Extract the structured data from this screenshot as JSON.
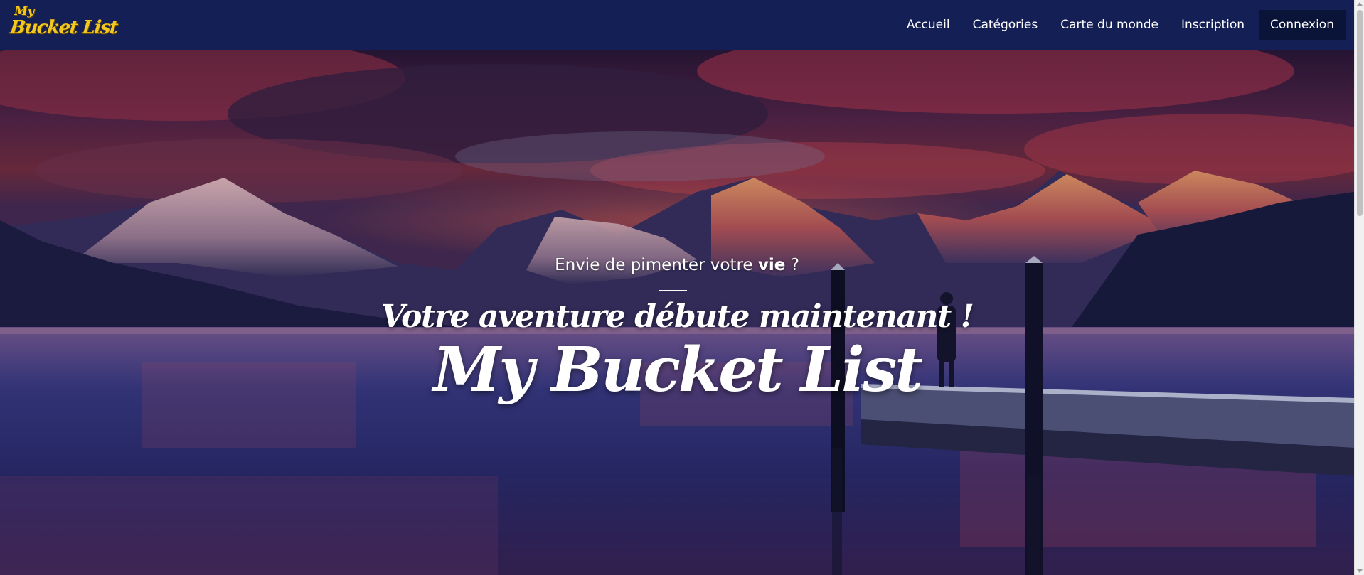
{
  "navbar": {
    "logo": {
      "line1": "My",
      "line2": "Bucket List"
    },
    "links": [
      {
        "label": "Accueil",
        "active": true
      },
      {
        "label": "Catégories"
      },
      {
        "label": "Carte du monde"
      },
      {
        "label": "Inscription"
      },
      {
        "label": "Connexion",
        "highlight": true
      }
    ]
  },
  "hero": {
    "tagline_prefix": "Envie de pimenter votre",
    "tagline_bold": "vie",
    "tagline_suffix": "?",
    "subtitle": "Votre aventure débute maintenant !",
    "title": "My Bucket List",
    "background_image": "sunset-mountain-lake-with-pier"
  },
  "colors": {
    "navbar_bg": "#142055",
    "cta_bg": "#0a1338",
    "logo_yellow": "#f4c81c",
    "text": "#ffffff"
  }
}
